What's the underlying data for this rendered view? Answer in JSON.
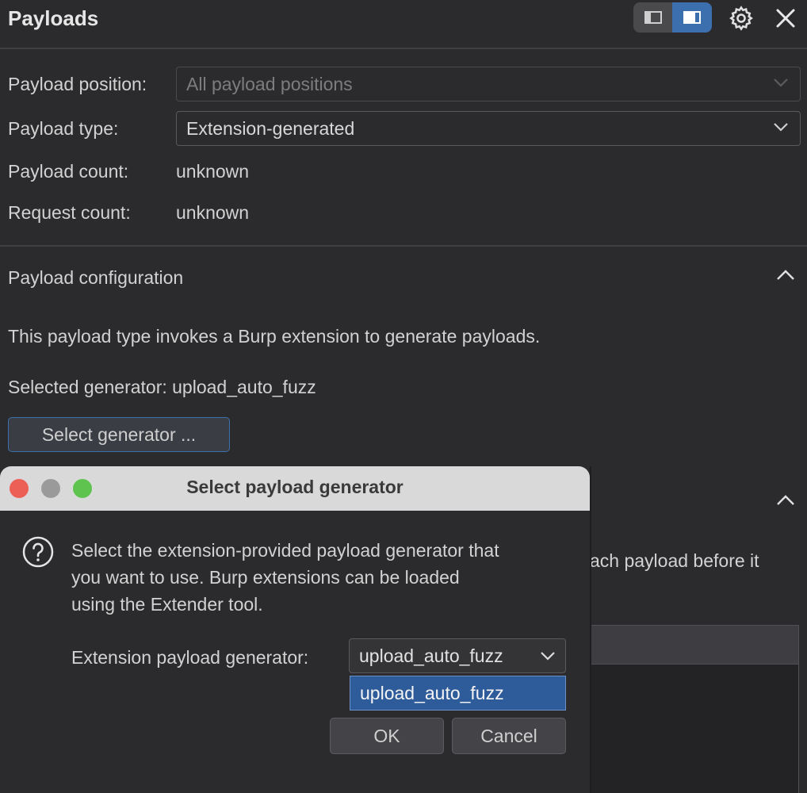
{
  "header": {
    "title": "Payloads",
    "layout_toggle": {
      "left_icon": "panel-left-icon",
      "right_icon": "panel-right-icon",
      "active": "right"
    },
    "settings_icon": "gear-icon",
    "close_icon": "close-icon"
  },
  "payload_sets": {
    "position_label": "Payload position:",
    "position_value": "All payload positions",
    "type_label": "Payload type:",
    "type_value": "Extension-generated",
    "payload_count_label": "Payload count:",
    "payload_count_value": "unknown",
    "request_count_label": "Request count:",
    "request_count_value": "unknown"
  },
  "config": {
    "section_title": "Payload configuration",
    "description": "This payload type invokes a Burp extension to generate payloads.",
    "selected_generator_label": "Selected generator:",
    "selected_generator_value": "upload_auto_fuzz",
    "select_button": "Select generator ..."
  },
  "background_partial": {
    "text": "ach payload before it"
  },
  "dialog": {
    "title": "Select payload generator",
    "message_line1": "Select the extension-provided payload generator that",
    "message_line2": "you want to use. Burp extensions can be loaded",
    "message_line3": "using the Extender tool.",
    "generator_label": "Extension payload generator:",
    "generator_value": "upload_auto_fuzz",
    "dropdown_options": [
      "upload_auto_fuzz"
    ],
    "ok_button": "OK",
    "cancel_button": "Cancel"
  },
  "colors": {
    "background": "#2b2b2d",
    "accent": "#3c6fae",
    "selection": "#2e5b9a",
    "traffic_red": "#ec5f57",
    "traffic_gray": "#9a9a9a",
    "traffic_green": "#5fc34f"
  }
}
